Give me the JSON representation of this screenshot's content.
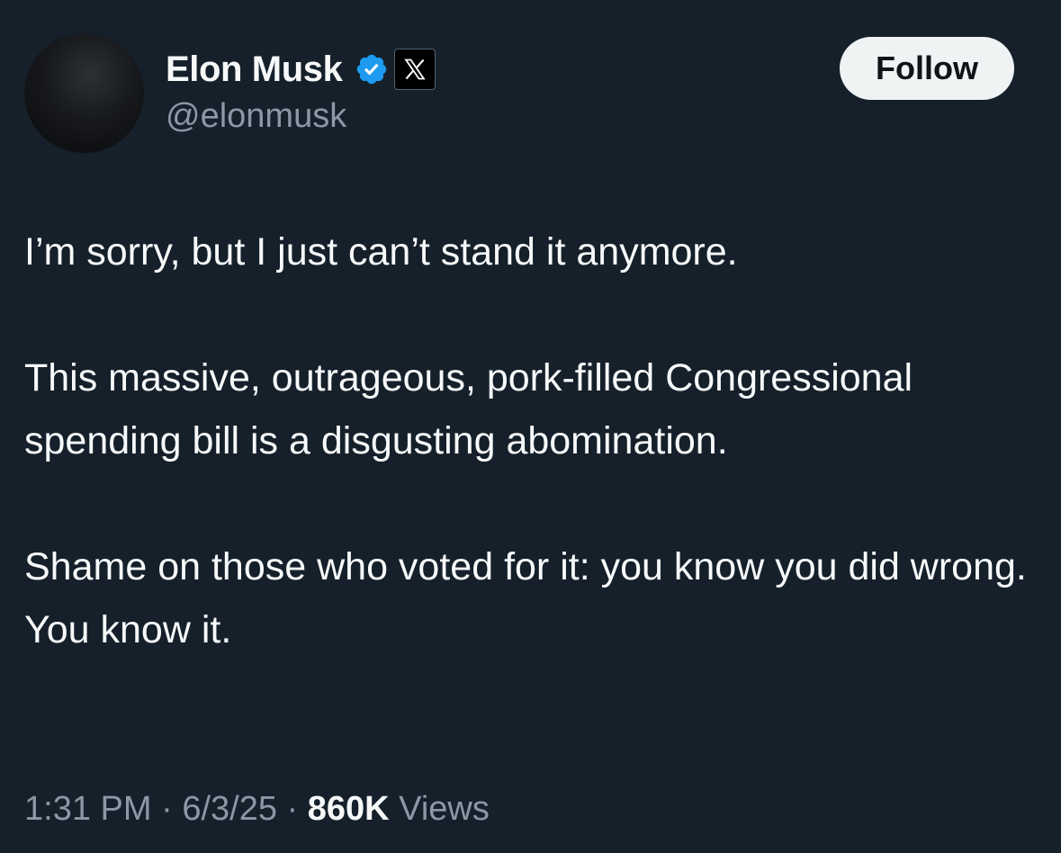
{
  "author": {
    "display_name": "Elon Musk",
    "handle": "@elonmusk",
    "verified_badge_icon": "verified-check-icon",
    "affiliate_badge_icon": "x-logo-icon",
    "verified_color": "#1d9bf0"
  },
  "follow_button": {
    "label": "Follow"
  },
  "tweet": {
    "paragraphs": [
      "I’m sorry, but I just can’t stand it anymore.",
      "This massive, outrageous, pork-filled Congressional spending bill is a disgusting abomination.",
      "Shame on those who voted for it: you know you did wrong. You know it."
    ]
  },
  "meta": {
    "time": "1:31 PM",
    "separator": "·",
    "date": "6/3/25",
    "views_count": "860K",
    "views_label": "Views"
  },
  "colors": {
    "background": "#15202b",
    "primary_text": "#f7f9f9",
    "secondary_text": "#8b98a5",
    "button_bg": "#eff3f4",
    "button_text": "#0f1419"
  }
}
